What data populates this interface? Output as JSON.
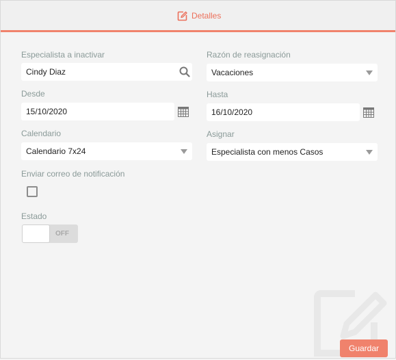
{
  "tab": {
    "label": "Detalles"
  },
  "form": {
    "especialista": {
      "label": "Especialista a inactivar",
      "value": "Cindy Diaz"
    },
    "razon": {
      "label": "Razón de reasignación",
      "value": "Vacaciones"
    },
    "desde": {
      "label": "Desde",
      "value": "15/10/2020"
    },
    "hasta": {
      "label": "Hasta",
      "value": "16/10/2020"
    },
    "calendario": {
      "label": "Calendario",
      "value": "Calendario 7x24"
    },
    "asignar": {
      "label": "Asignar",
      "value": "Especialista con menos Casos"
    },
    "notificacion": {
      "label": "Enviar correo de notificación",
      "checked": false
    },
    "estado": {
      "label": "Estado",
      "state": "OFF"
    }
  },
  "actions": {
    "save_label": "Guardar"
  },
  "colors": {
    "accent": "#f0826c",
    "label": "#8a9a98"
  }
}
